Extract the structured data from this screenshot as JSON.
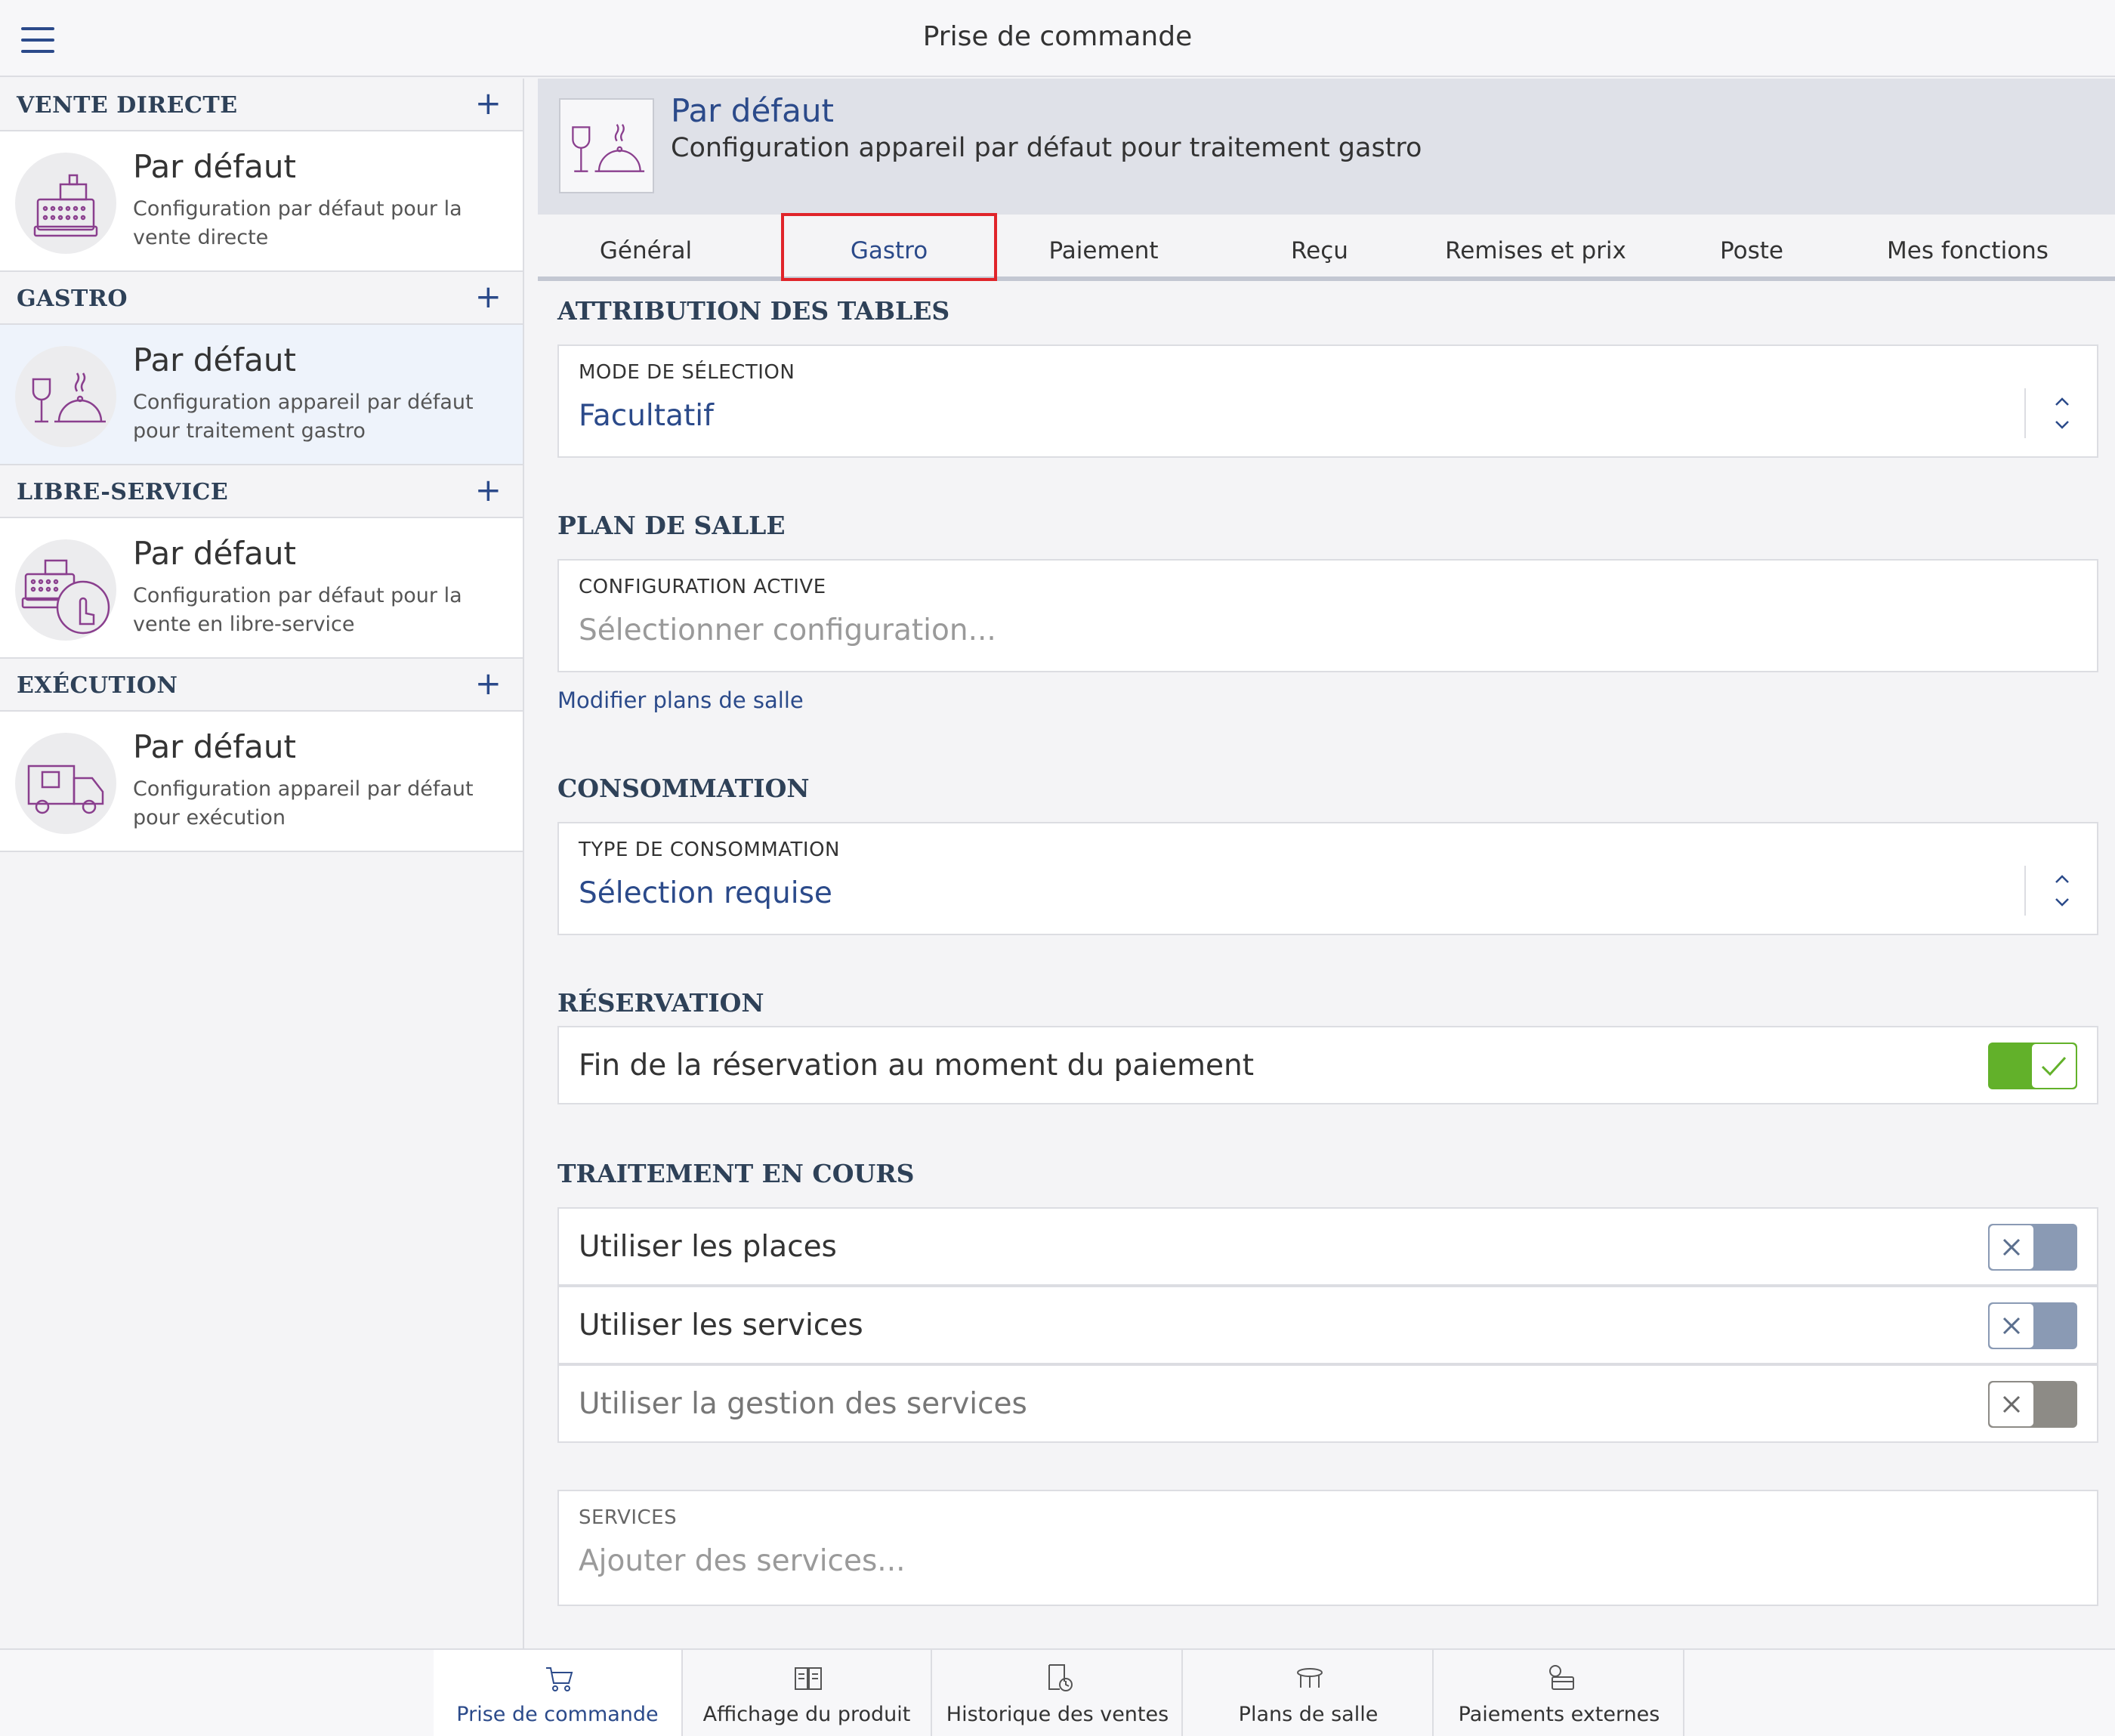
{
  "app": {
    "title": "Prise de commande"
  },
  "sidebar": {
    "sections": [
      {
        "title": "VENTE DIRECTE",
        "add": "+",
        "item": {
          "title": "Par défaut",
          "desc": "Configuration par défaut pour la vente directe",
          "icon": "cash-register-icon"
        }
      },
      {
        "title": "GASTRO",
        "add": "+",
        "item": {
          "title": "Par défaut",
          "desc": "Configuration appareil par défaut pour traitement gastro",
          "icon": "wine-cloche-icon"
        }
      },
      {
        "title": "LIBRE-SERVICE",
        "add": "+",
        "item": {
          "title": "Par défaut",
          "desc": "Configuration par défaut pour la vente en libre-service",
          "icon": "self-service-icon"
        }
      },
      {
        "title": "EXÉCUTION",
        "add": "+",
        "item": {
          "title": "Par défaut",
          "desc": "Configuration appareil par défaut pour exécution",
          "icon": "delivery-truck-icon"
        }
      }
    ],
    "selected_index": 1
  },
  "header": {
    "title": "Par défaut",
    "desc": "Configuration appareil par défaut pour traitement gastro",
    "icon": "wine-cloche-icon"
  },
  "tabs": [
    "Général",
    "Gastro",
    "Paiement",
    "Reçu",
    "Remises et prix",
    "Poste",
    "Mes fonctions"
  ],
  "active_tab": "Gastro",
  "content": {
    "attribution": {
      "heading": "ATTRIBUTION DES TABLES",
      "field_label": "MODE DE SÉLECTION",
      "value": "Facultatif"
    },
    "plan": {
      "heading": "PLAN DE SALLE",
      "field_label": "CONFIGURATION ACTIVE",
      "placeholder": "Sélectionner configuration...",
      "link": "Modifier plans de salle"
    },
    "consommation": {
      "heading": "CONSOMMATION",
      "field_label": "TYPE DE CONSOMMATION",
      "value": "Sélection requise"
    },
    "reservation": {
      "heading": "RÉSERVATION",
      "row_label": "Fin de la réservation au moment du paiement",
      "toggle": true
    },
    "traitement": {
      "heading": "TRAITEMENT EN COURS",
      "rows": [
        {
          "label": "Utiliser les places",
          "toggle": false
        },
        {
          "label": "Utiliser les services",
          "toggle": false
        },
        {
          "label": "Utiliser la gestion des services",
          "toggle": false
        }
      ]
    },
    "services": {
      "field_label": "SERVICES",
      "placeholder": "Ajouter des services..."
    }
  },
  "bottom_nav": [
    {
      "label": "Prise de commande",
      "icon": "cart-icon",
      "active": true
    },
    {
      "label": "Affichage du produit",
      "icon": "menu-book-icon",
      "active": false
    },
    {
      "label": "Historique des ventes",
      "icon": "receipt-clock-icon",
      "active": false
    },
    {
      "label": "Plans de salle",
      "icon": "table-icon",
      "active": false
    },
    {
      "label": "Paiements externes",
      "icon": "card-payment-icon",
      "active": false
    }
  ],
  "colors": {
    "accent": "#2b4a8a",
    "toggle_on": "#62b12a",
    "toggle_off": "#8a9ab4",
    "highlight_border": "#e0242a"
  }
}
